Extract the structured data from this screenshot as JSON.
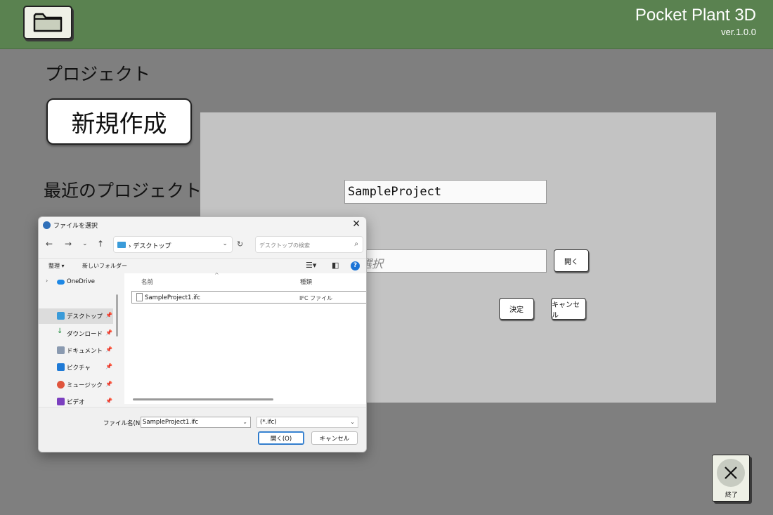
{
  "app": {
    "title": "Pocket Plant 3D",
    "version": "ver.1.0.0"
  },
  "left": {
    "project_heading": "プロジェクト",
    "new_button": "新規作成",
    "recent_heading": "最近のプロジェクト"
  },
  "panel": {
    "project_name_value": "SampleProject",
    "file_select_visible_text": "ル選択",
    "open_button": "開く",
    "ok_button": "決定",
    "cancel_button": "キャンセル"
  },
  "exit": {
    "label": "終了"
  },
  "file_dialog": {
    "title": "ファイルを選択",
    "address": "デスクトップ",
    "search_placeholder": "デスクトップの検索",
    "toolbar": {
      "organize": "整理 ▾",
      "new_folder": "新しいフォルダー"
    },
    "sidebar": [
      {
        "label": "OneDrive"
      },
      {
        "label": "デスクトップ"
      },
      {
        "label": "ダウンロード"
      },
      {
        "label": "ドキュメント"
      },
      {
        "label": "ピクチャ"
      },
      {
        "label": "ミュージック"
      },
      {
        "label": "ビデオ"
      }
    ],
    "columns": {
      "name": "名前",
      "type": "種類"
    },
    "files": [
      {
        "name": "SampleProject1.ifc",
        "type": "IFC ファイル"
      }
    ],
    "filename_label": "ファイル名(N):",
    "filename_value": "SampleProject1.ifc",
    "filter": "(*.ifc)",
    "open_button": "開く(O)",
    "cancel_button": "キャンセル"
  },
  "colors": {
    "header": "#5a8250",
    "background": "#7f7f7f",
    "panel": "#c3c3c3",
    "accent": "#1f6fc5"
  }
}
